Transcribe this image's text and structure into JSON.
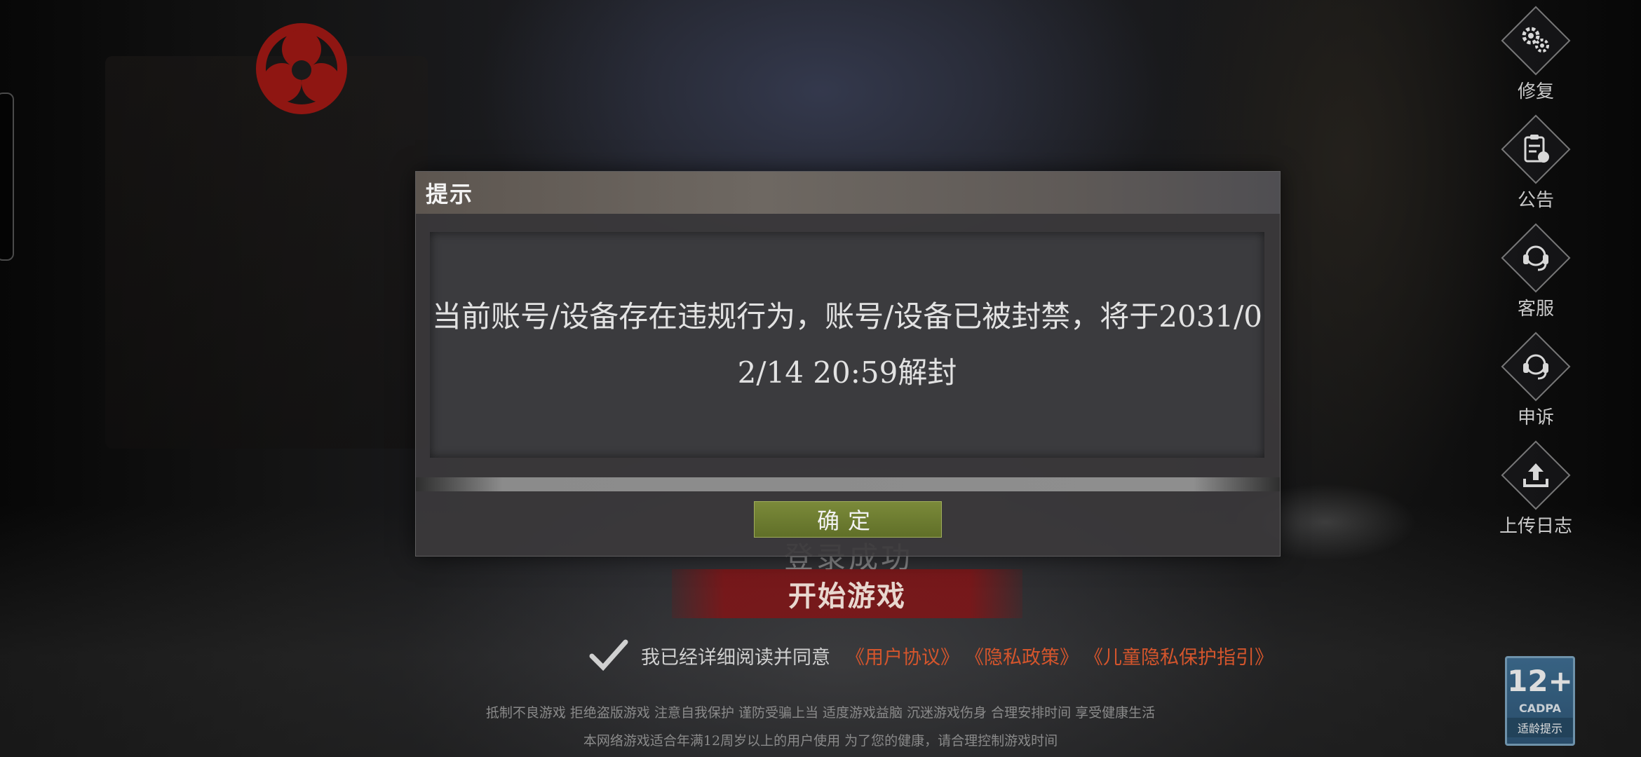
{
  "dialog": {
    "title": "提示",
    "message": "当前账号/设备存在违规行为，账号/设备已被封禁，将于2031/02/14 20:59解封",
    "confirm_label": "确定"
  },
  "right_menu": {
    "items": [
      {
        "label": "修复",
        "icon": "gears-icon"
      },
      {
        "label": "公告",
        "icon": "notice-clipboard-icon"
      },
      {
        "label": "客服",
        "icon": "customer-service-headset-icon"
      },
      {
        "label": "申诉",
        "icon": "appeal-headset-icon"
      },
      {
        "label": "上传日志",
        "icon": "upload-icon"
      }
    ]
  },
  "login": {
    "status": "登录成功",
    "start_label": "开始游戏"
  },
  "agreement": {
    "text": "我已经详细阅读并同意",
    "links": [
      "《用户协议》",
      "《隐私政策》",
      "《儿童隐私保护指引》"
    ]
  },
  "notices": {
    "line1": "抵制不良游戏 拒绝盗版游戏 注意自我保护 谨防受骗上当 适度游戏益脑 沉迷游戏伤身 合理安排时间 享受健康生活",
    "line2": "本网络游戏适合年满12周岁以上的用户使用  为了您的健康，请合理控制游戏时间"
  },
  "age_badge": {
    "rating": "12+",
    "org": "CADPA",
    "tip": "适龄提示"
  },
  "colors": {
    "confirm_button": "#6f7e32",
    "start_button": "#821416",
    "link": "#d4552c",
    "badge": "#3d6f95"
  }
}
